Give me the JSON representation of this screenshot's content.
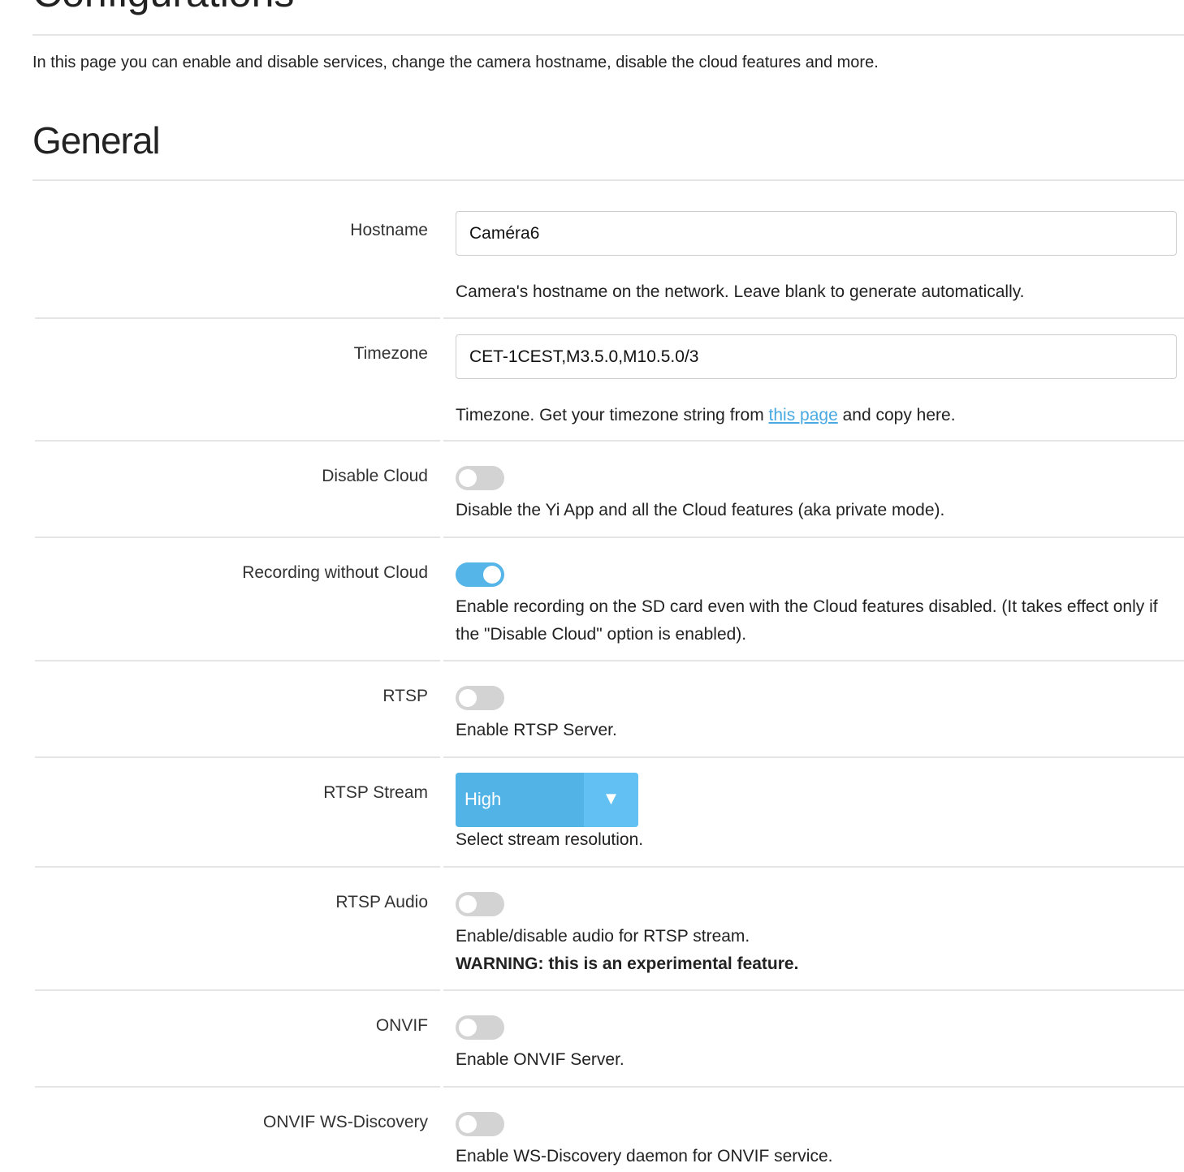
{
  "page_title": "Configurations",
  "intro": "In this page you can enable and disable services, change the camera hostname, disable the cloud features and more.",
  "section_title": "General",
  "accent_color": "#55b5e8",
  "hostname": {
    "label": "Hostname",
    "value": "Caméra6",
    "help": "Camera's hostname on the network. Leave blank to generate automatically."
  },
  "timezone": {
    "label": "Timezone",
    "value": "CET-1CEST,M3.5.0,M10.5.0/3",
    "help_before": "Timezone. Get your timezone string from ",
    "help_link": "this page",
    "help_after": " and copy here."
  },
  "disable_cloud": {
    "label": "Disable Cloud",
    "enabled": false,
    "help": "Disable the Yi App and all the Cloud features (aka private mode)."
  },
  "recording_without_cloud": {
    "label": "Recording without Cloud",
    "enabled": true,
    "help": "Enable recording on the SD card even with the Cloud features disabled. (It takes effect only if the \"Disable Cloud\" option is enabled)."
  },
  "rtsp": {
    "label": "RTSP",
    "enabled": false,
    "help": "Enable RTSP Server."
  },
  "rtsp_stream": {
    "label": "RTSP Stream",
    "value": "High",
    "arrow": "▼",
    "help": "Select stream resolution."
  },
  "rtsp_audio": {
    "label": "RTSP Audio",
    "enabled": false,
    "help": "Enable/disable audio for RTSP stream.",
    "warning": "WARNING: this is an experimental feature."
  },
  "onvif": {
    "label": "ONVIF",
    "enabled": false,
    "help": "Enable ONVIF Server."
  },
  "onvif_ws": {
    "label": "ONVIF WS-Discovery",
    "enabled": false,
    "help": "Enable WS-Discovery daemon for ONVIF service."
  }
}
